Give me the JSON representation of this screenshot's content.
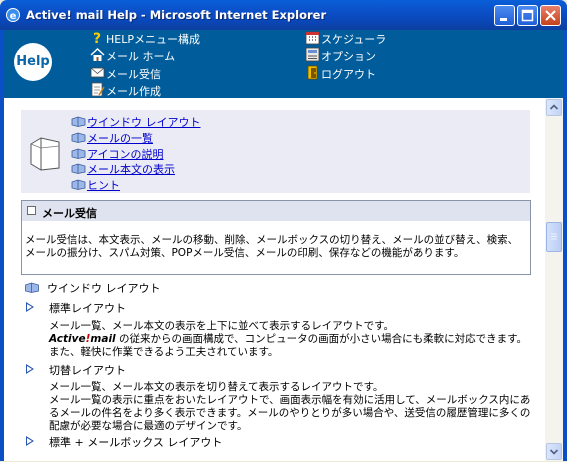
{
  "window": {
    "title": "Active! mail Help - Microsoft Internet Explorer",
    "controls": {
      "minimize": "minimize-icon",
      "maximize": "maximize-icon",
      "close": "close-icon"
    }
  },
  "header": {
    "logo_text": "Help",
    "nav": [
      {
        "label": "HELPメニュー構成",
        "icon": "question-icon"
      },
      {
        "label": "メール ホーム",
        "icon": "home-icon"
      },
      {
        "label": "メール受信",
        "icon": "mail-icon"
      },
      {
        "label": "メール作成",
        "icon": "compose-icon"
      },
      {
        "label": "スケジューラ",
        "icon": "calendar-icon"
      },
      {
        "label": "オプション",
        "icon": "options-icon"
      },
      {
        "label": "ログアウト",
        "icon": "logout-icon"
      }
    ]
  },
  "menu": {
    "links": [
      "ウインドウ レイアウト",
      "メールの一覧",
      "アイコンの説明",
      "メール本文の表示",
      "ヒント"
    ]
  },
  "section": {
    "title": "メール受信",
    "body": "メール受信は、本文表示、メールの移動、削除、メールボックスの切り替え、メールの並び替え、検索、メールの振分け、スパム対策、POPメール受信、メールの印刷、保存などの機能があります。"
  },
  "layout": {
    "heading": "ウインドウ レイアウト",
    "items": [
      {
        "title": "標準レイアウト",
        "line1": "メール一覧、メール本文の表示を上下に並べて表示するレイアウトです。",
        "brand_prefix": "Active",
        "brand_excl": "!",
        "brand_suffix": "mail",
        "line2_rest": " の従来からの画面構成で、コンピュータの画面が小さい場合にも柔軟に対応できます。また、軽快に作業できるよう工夫されています。"
      },
      {
        "title": "切替レイアウト",
        "line1": "メール一覧、メール本文の表示を切り替えて表示するレイアウトです。",
        "line2": "メール一覧の表示に重点をおいたレイアウトで、画面表示幅を有効に活用して、メールボックス内にあるメールの件名をより多く表示できます。メールのやりとりが多い場合や、送受信の履歴管理に多くの配慮が必要な場合に最適のデザインです。"
      },
      {
        "title": "標準 + メールボックス レイアウト"
      }
    ]
  },
  "colors": {
    "titlebar": "#0b4fc7",
    "header_bg": "#005c9a",
    "menu_bg": "#eaebf5",
    "link": "#0000cc"
  }
}
